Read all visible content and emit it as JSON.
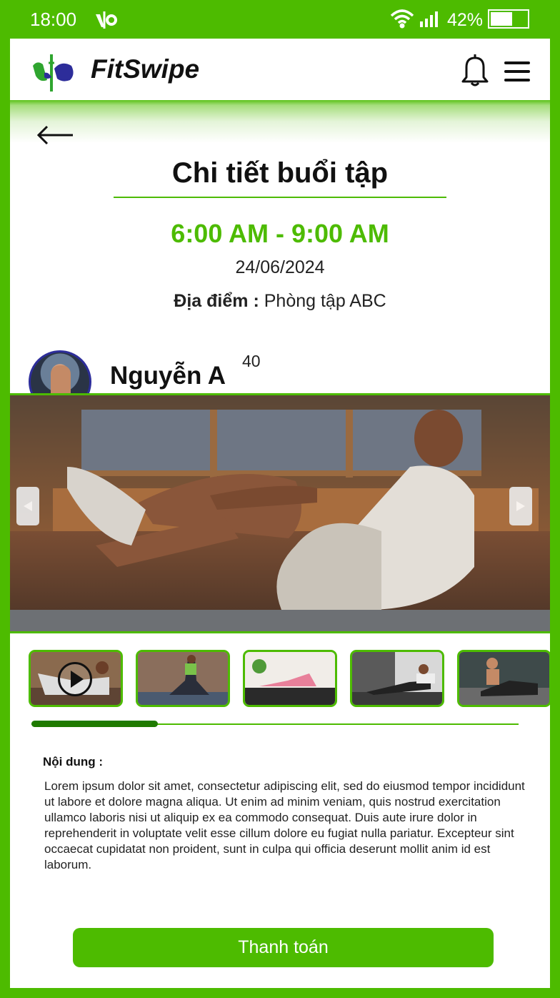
{
  "status_bar": {
    "time": "18:00",
    "battery_pct": "42%",
    "battery_level": 0.6
  },
  "app_bar": {
    "brand": "FitSwipe",
    "icons": [
      "fitswipe-logo-icon",
      "bell-icon",
      "hamburger-menu-icon"
    ]
  },
  "page": {
    "title": "Chi tiết buổi tập",
    "time_range": "6:00 AM - 9:00 AM",
    "date": "24/06/2024",
    "location_label": "Địa điểm :",
    "location_value": "Phòng tập ABC"
  },
  "trainer": {
    "name": "Nguyễn A",
    "age": "40"
  },
  "gallery": {
    "thumbnail_count": 5,
    "progress": 0.26,
    "first_is_video": true
  },
  "content": {
    "label": "Nội dung :",
    "text": "Lorem ipsum dolor sit amet, consectetur adipiscing elit, sed do eiusmod tempor incididunt ut labore et dolore magna aliqua. Ut enim ad minim veniam, quis nostrud exercitation ullamco laboris nisi ut aliquip ex ea commodo consequat. Duis aute irure dolor in reprehenderit in voluptate velit esse cillum dolore eu fugiat nulla pariatur. Excepteur sint occaecat cupidatat non proident, sunt in culpa qui officia deserunt mollit anim id est laborum."
  },
  "actions": {
    "pay_label": "Thanh toán"
  },
  "colors": {
    "brand_green": "#4dbb00",
    "progress_dark": "#1f7a00"
  }
}
